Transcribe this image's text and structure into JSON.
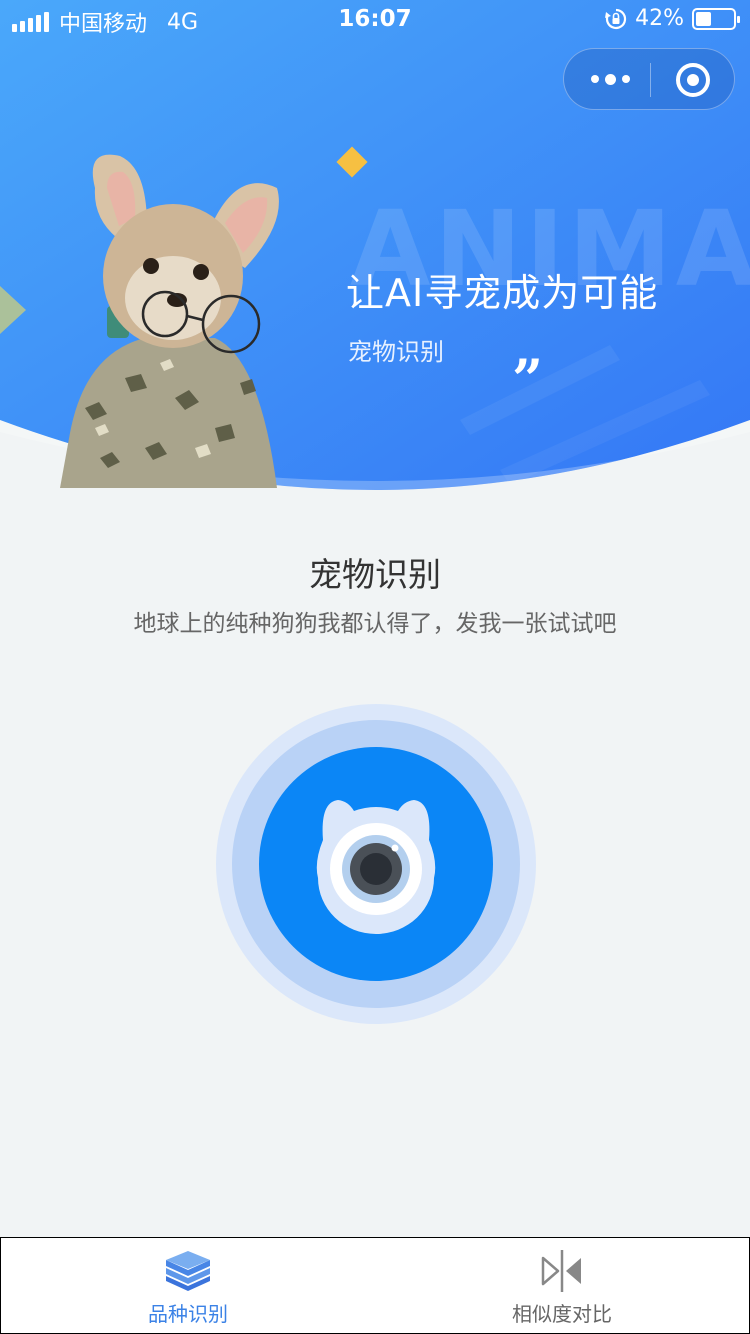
{
  "status_bar": {
    "carrier": "中国移动",
    "network": "4G",
    "time": "16:07",
    "battery_percent": "42%",
    "battery_level": 0.42
  },
  "hero": {
    "background_word": "ANIMAL",
    "title": "让AI寻宠成为可能",
    "subtitle": "宠物识别",
    "quote_mark": "”",
    "gradient_start": "#4aa8fa",
    "gradient_end": "#3477f5"
  },
  "main": {
    "title": "宠物识别",
    "description": "地球上的纯种狗狗我都认得了，发我一张试试吧"
  },
  "tabbar": {
    "active_color": "#3b82e6",
    "tabs": [
      {
        "label": "品种识别",
        "icon": "layers-icon"
      },
      {
        "label": "相似度对比",
        "icon": "compare-icon"
      }
    ]
  }
}
